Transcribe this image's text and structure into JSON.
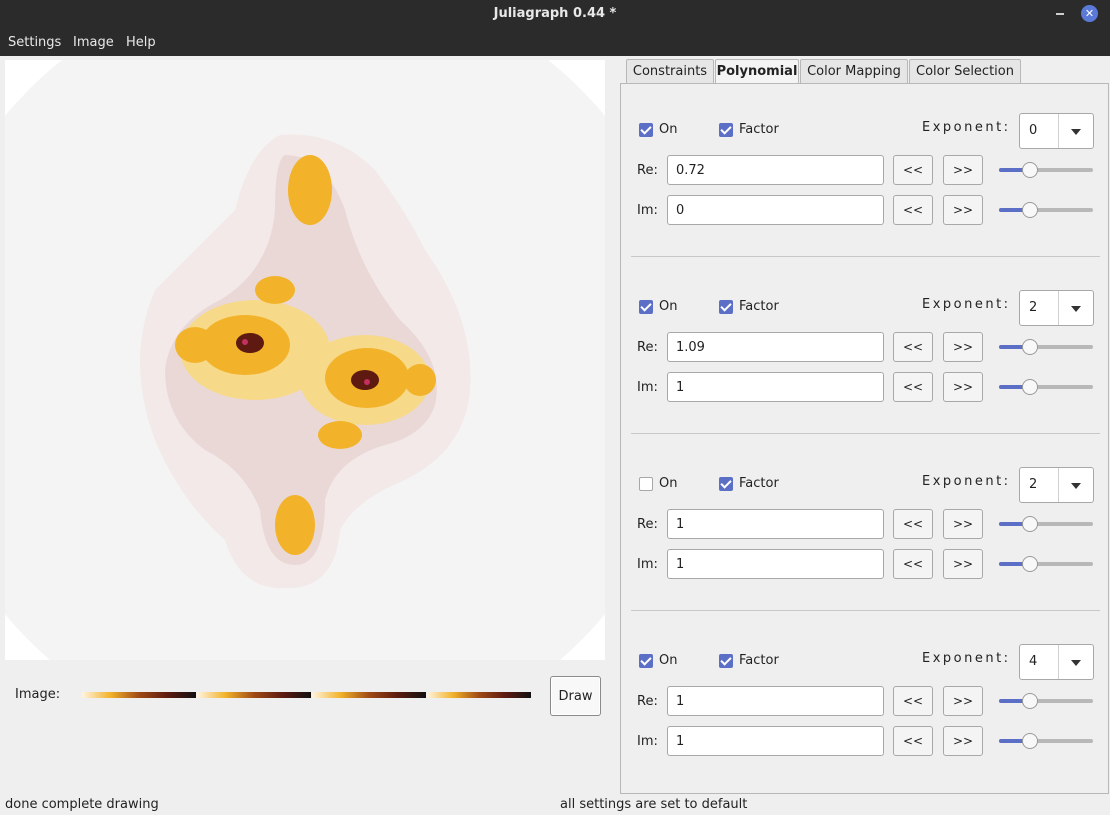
{
  "window": {
    "title": "Juliagraph 0.44 *",
    "minimize_icon": "minimize-icon",
    "close_icon": "close-icon",
    "close_glyph": "✕"
  },
  "menu": [
    "Settings",
    "Image",
    "Help"
  ],
  "image_row": {
    "label": "Image:",
    "gradient_colors": [
      "#fff4e0",
      "#f2b32a",
      "#a04a15",
      "#5e1a10",
      "#101010"
    ]
  },
  "draw_label": "Draw",
  "status": {
    "left": "done complete drawing",
    "right": "all settings are set to default"
  },
  "tabs": [
    {
      "label": "Constraints",
      "active": false
    },
    {
      "label": "Polynomial",
      "active": true
    },
    {
      "label": "Color Mapping",
      "active": false
    },
    {
      "label": "Color Selection",
      "active": false
    }
  ],
  "labels": {
    "on": "On",
    "factor": "Factor",
    "exponent": "Exponent:",
    "re": "Re:",
    "im": "Im:",
    "prev": "<<",
    "next": ">>"
  },
  "accent_color": "#5b6fc6",
  "polynomial": [
    {
      "on": true,
      "factor": true,
      "exponent": "0",
      "re": "0.72",
      "im": "0",
      "re_slider": 0.3,
      "im_slider": 0.3
    },
    {
      "on": true,
      "factor": true,
      "exponent": "2",
      "re": "1.09",
      "im": "1",
      "re_slider": 0.3,
      "im_slider": 0.3
    },
    {
      "on": false,
      "factor": true,
      "exponent": "2",
      "re": "1",
      "im": "1",
      "re_slider": 0.3,
      "im_slider": 0.3
    },
    {
      "on": true,
      "factor": true,
      "exponent": "4",
      "re": "1",
      "im": "1",
      "re_slider": 0.3,
      "im_slider": 0.3
    }
  ],
  "fractal_colors": {
    "halo": "#f4f4f4",
    "outer": "#f2e9e8",
    "inner": "#ead8d6",
    "core": "#f7d98a",
    "gold": "#f2b32a",
    "dark": "#5e1a10",
    "accent": "#c43060"
  }
}
